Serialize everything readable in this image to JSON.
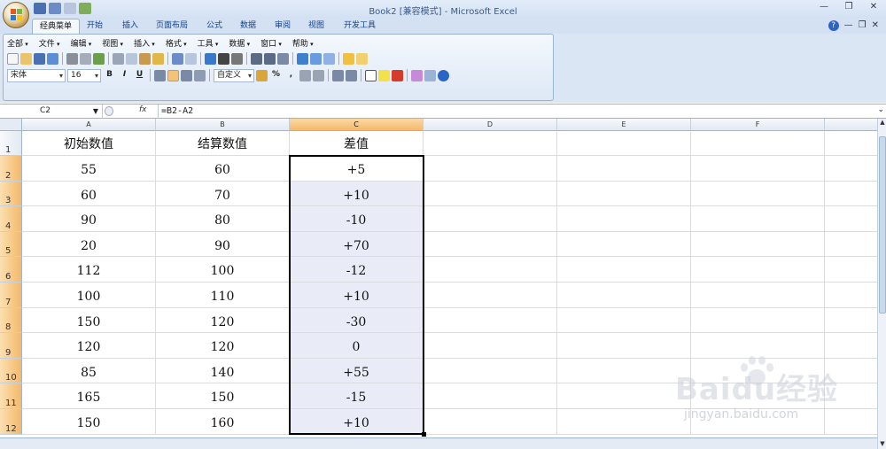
{
  "titlebar": {
    "title": "Book2  [兼容模式] - Microsoft Excel"
  },
  "ribbon_tabs": [
    {
      "label": "经典菜单",
      "active": true
    },
    {
      "label": "开始"
    },
    {
      "label": "插入"
    },
    {
      "label": "页面布局"
    },
    {
      "label": "公式"
    },
    {
      "label": "数据"
    },
    {
      "label": "审阅"
    },
    {
      "label": "视图"
    },
    {
      "label": "开发工具"
    }
  ],
  "classic_menu": [
    "全部",
    "文件",
    "编辑",
    "视图",
    "插入",
    "格式",
    "工具",
    "数据",
    "窗口",
    "帮助"
  ],
  "toolbar": {
    "font_name": "宋体",
    "font_size": "16",
    "bold": "B",
    "italic": "I",
    "underline": "U",
    "number_format": "自定义",
    "percent": "%",
    "comma": ","
  },
  "formula_bar": {
    "name_box": "C2",
    "fx_label": "fx",
    "formula": "=B2-A2"
  },
  "columns": [
    "A",
    "B",
    "C",
    "D",
    "E",
    "F"
  ],
  "selected_column": "C",
  "rows": [
    "1",
    "2",
    "3",
    "4",
    "5",
    "6",
    "7",
    "8",
    "9",
    "10",
    "11",
    "12"
  ],
  "table": {
    "headers": [
      "初始数值",
      "结算数值",
      "差值"
    ],
    "data": [
      [
        "55",
        "60",
        "+5"
      ],
      [
        "60",
        "70",
        "+10"
      ],
      [
        "90",
        "80",
        "-10"
      ],
      [
        "20",
        "90",
        "+70"
      ],
      [
        "112",
        "100",
        "-12"
      ],
      [
        "100",
        "110",
        "+10"
      ],
      [
        "150",
        "120",
        "-30"
      ],
      [
        "120",
        "120",
        "0"
      ],
      [
        "85",
        "140",
        "+55"
      ],
      [
        "165",
        "150",
        "-15"
      ],
      [
        "150",
        "160",
        "+10"
      ]
    ]
  },
  "watermark": {
    "main": "Baidu经验",
    "sub": "jingyan.baidu.com"
  },
  "colors": {
    "selection_fill": "#e9ecf6",
    "header_highlight": "#f5b86a",
    "ribbon_bg": "#dbe6f4",
    "title_text": "#3b5a86"
  }
}
